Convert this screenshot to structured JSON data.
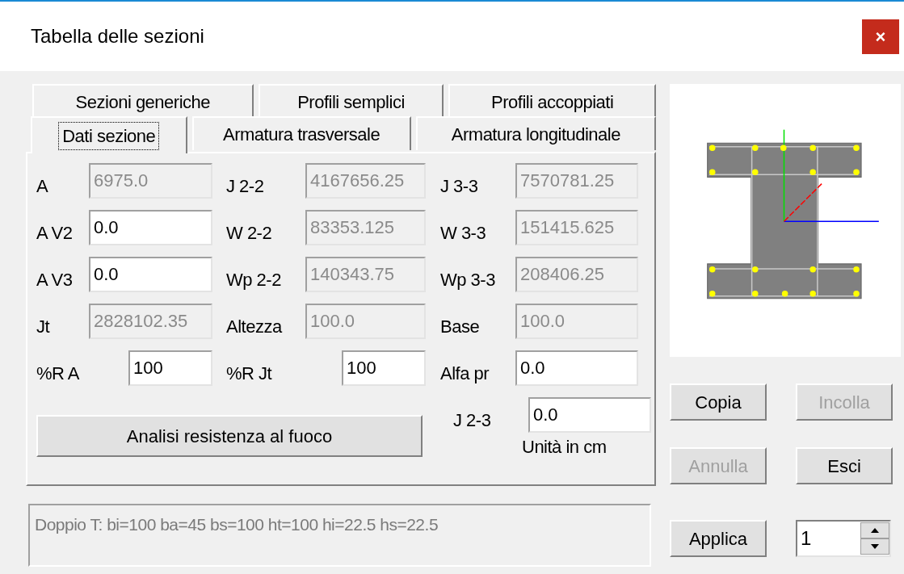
{
  "window": {
    "title": "Tabella delle sezioni",
    "close": "×"
  },
  "tab_rows": [
    [
      {
        "label": "Sezioni generiche",
        "selected": false
      },
      {
        "label": "Profili semplici",
        "selected": false
      },
      {
        "label": "Profili accoppiati",
        "selected": false
      }
    ],
    [
      {
        "label": "Dati sezione",
        "selected": true
      },
      {
        "label": "Armatura trasversale",
        "selected": false
      },
      {
        "label": "Armatura longitudinale",
        "selected": false
      }
    ]
  ],
  "field_rows": [
    [
      {
        "label": "A",
        "value": "6975.0",
        "disabled": true
      },
      {
        "label": "J 2-2",
        "value": "4167656.25",
        "disabled": true
      },
      {
        "label": "J 3-3",
        "value": "7570781.25",
        "disabled": true
      }
    ],
    [
      {
        "label": "A V2",
        "value": "0.0",
        "disabled": false
      },
      {
        "label": "W 2-2",
        "value": "83353.125",
        "disabled": true
      },
      {
        "label": "W 3-3",
        "value": "151415.625",
        "disabled": true
      }
    ],
    [
      {
        "label": "A V3",
        "value": "0.0",
        "disabled": false
      },
      {
        "label": "Wp 2-2",
        "value": "140343.75",
        "disabled": true
      },
      {
        "label": "Wp 3-3",
        "value": "208406.25",
        "disabled": true
      }
    ],
    [
      {
        "label": "Jt",
        "value": "2828102.35",
        "disabled": true
      },
      {
        "label": "Altezza",
        "value": "100.0",
        "disabled": true
      },
      {
        "label": "Base",
        "value": "100.0",
        "disabled": true
      }
    ],
    [
      {
        "label": "%R A",
        "value": "100",
        "disabled": false,
        "narrow": true
      },
      {
        "label": "%R Jt",
        "value": "100",
        "disabled": false,
        "narrow": true
      },
      {
        "label": "Alfa pr",
        "value": "0.0",
        "disabled": false
      }
    ]
  ],
  "fire_button": "Analisi resistenza al fuoco",
  "j23": {
    "label": "J 2-3",
    "value": "0.0",
    "disabled": false
  },
  "units_note": "Unità in cm",
  "status": "Doppio T: bi=100 ba=45 bs=100 ht=100 hi=22.5 hs=22.5",
  "buttons": [
    {
      "label": "Copia",
      "disabled": false
    },
    {
      "label": "Incolla",
      "disabled": true
    },
    {
      "label": "Annulla",
      "disabled": true
    },
    {
      "label": "Esci",
      "disabled": false
    }
  ],
  "apply_button": {
    "label": "Applica",
    "disabled": false
  },
  "spinner": {
    "value": "1"
  }
}
